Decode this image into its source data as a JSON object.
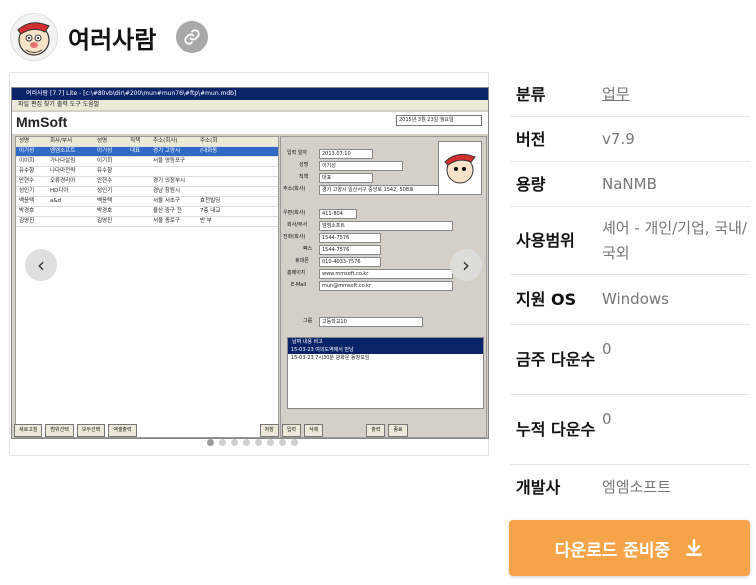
{
  "app": {
    "title": "여러사람",
    "logo_icon": "cartoon-face-icon",
    "link_icon": "link-icon"
  },
  "gallery": {
    "prev_icon": "chevron-left-icon",
    "next_icon": "chevron-right-icon",
    "dot_count": 8,
    "active_dot": 0,
    "screenshot": {
      "window_title": "여러사람 [7.7] Lite - [c:\\#80vb\\dir\\#200\\mun#mun76\\#ftp\\#mun.mdb]",
      "menu": "파일  편집  찾기  출력  도구  도움말",
      "brand": "MmSoft",
      "date": "2015년  3월 23일 월요일",
      "grid_headers": [
        "성명",
        "회사/부서",
        "성명",
        "직책",
        "주소(회사)",
        "주소(회"
      ],
      "grid_rows": [
        [
          "이기성",
          "엠엠소프트",
          "이기성",
          "대표",
          "경기 고양시",
          "(대화동"
        ],
        [
          "이이희",
          "가나다살림",
          "이기희",
          "",
          "서울 영등포구",
          ""
        ],
        [
          "유수향",
          "나다마전략",
          "유수향",
          "",
          "",
          ""
        ],
        [
          "안현수",
          "오류경리아",
          "안현수",
          "",
          "경기 의정부시",
          ""
        ],
        [
          "성인기",
          "HD디아",
          "성인기",
          "",
          "경남 창원시",
          ""
        ],
        [
          "백윤택",
          "a&d",
          "백윤택",
          "",
          "서울 서초구",
          "효천빌딩"
        ],
        [
          "박경호",
          "",
          "박경호",
          "",
          "울산 중구 전",
          "7층 내교"
        ],
        [
          "김영진",
          "",
          "김영진",
          "",
          "서울 종로구",
          "반 부"
        ]
      ],
      "detail_fields": [
        {
          "label": "입력 일자",
          "value": "2013.07.10"
        },
        {
          "label": "성명",
          "value": "이기성"
        },
        {
          "label": "직책",
          "value": "대표"
        },
        {
          "label": "주소(회사)",
          "value": "경기 고양시 일산서구 중앙로 1542, 508호"
        },
        {
          "label": "우편(회사)",
          "value": "411-804"
        },
        {
          "label": "회사/부서",
          "value": "엠엠소프트"
        },
        {
          "label": "전화(회사)",
          "value": "1544-7576"
        },
        {
          "label": "팩스",
          "value": "1544-7576"
        },
        {
          "label": "휴대폰",
          "value": "010-4033-7576"
        },
        {
          "label": "홈페이지",
          "value": "www.mmsoft.co.kr"
        },
        {
          "label": "E-Mail",
          "value": "mun@mmsoft.co.kr"
        },
        {
          "label": "그룹",
          "value": "고등학교10"
        }
      ],
      "memo_headers": "날짜        내용                      비고",
      "memo_rows": [
        "15-03-23  여의도역에서 만남",
        "15-03-23  7시30분 광화문             동창모임"
      ],
      "buttons": [
        "새로고침",
        "범위선택",
        "모두선택",
        "엑셀출력",
        "저장",
        "입력",
        "삭제",
        "출력",
        "종료"
      ]
    }
  },
  "info": [
    {
      "label": "분류",
      "value": "업무",
      "link": true
    },
    {
      "label": "버전",
      "value": "v7.9",
      "link": false
    },
    {
      "label": "용량",
      "value": "NaNMB",
      "link": false
    },
    {
      "label": "사용범위",
      "value": "셰어 - 개인/기업, 국내/국외",
      "link": false
    },
    {
      "label": "지원 OS",
      "value": "Windows",
      "link": false
    },
    {
      "label": "금주 다운수",
      "value": "0",
      "link": false
    },
    {
      "label": "누적 다운수",
      "value": "0",
      "link": false
    },
    {
      "label": "개발사",
      "value": "엠엠소프트",
      "link": false
    }
  ],
  "download": {
    "label": "다운로드 준비중",
    "icon": "download-icon"
  },
  "colors": {
    "accent": "#f5a44a",
    "label_text": "#111111",
    "value_text": "#777777"
  }
}
